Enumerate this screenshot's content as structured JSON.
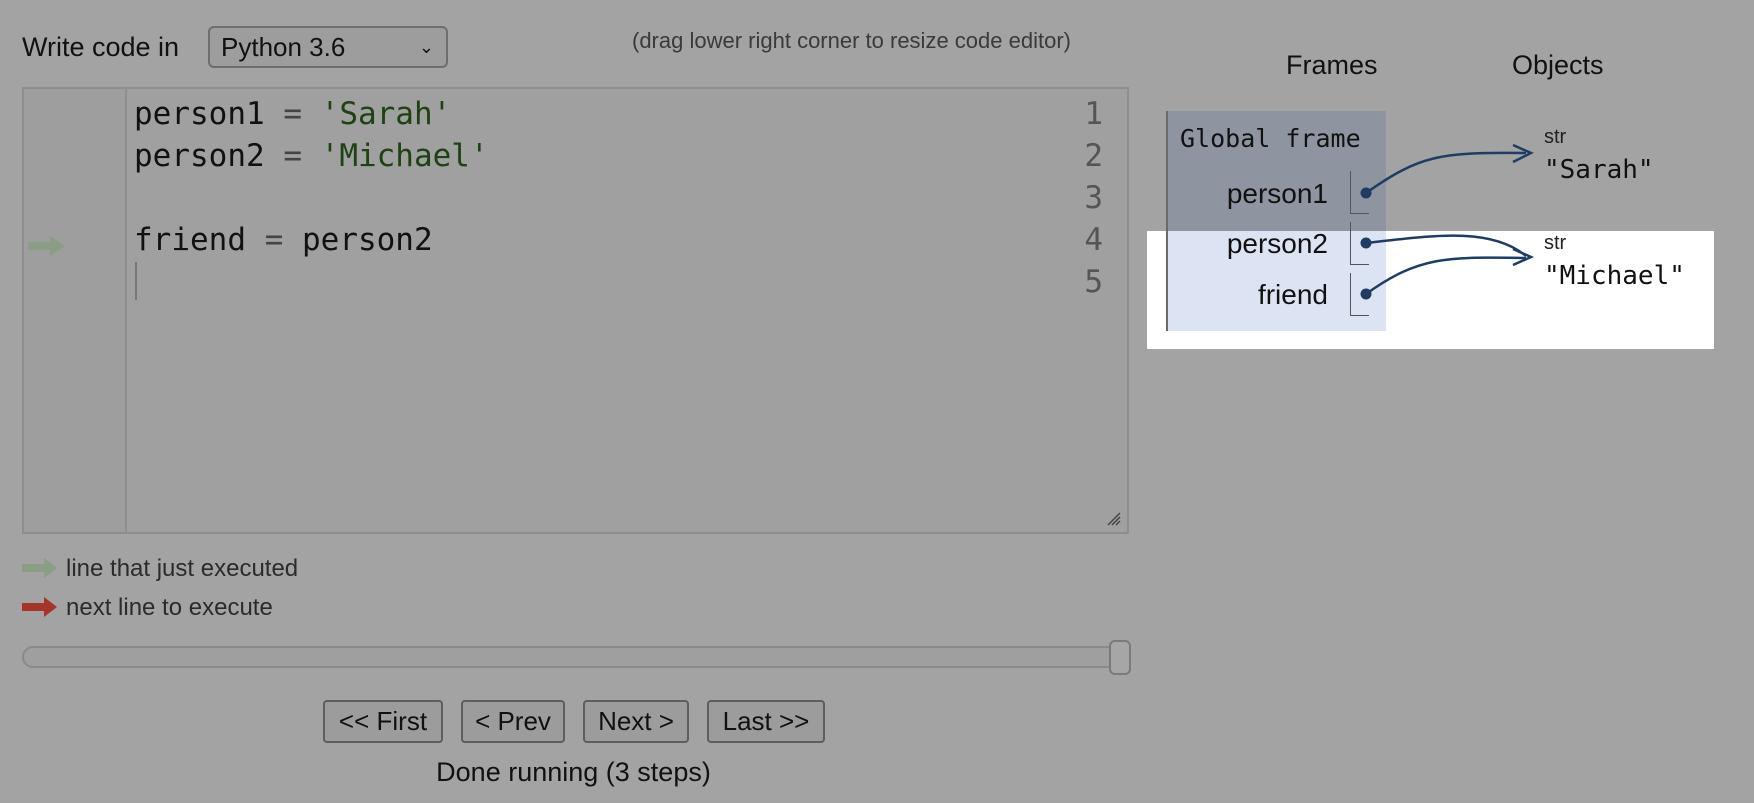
{
  "toolbar": {
    "lang_label": "Write code in",
    "lang_selected": "Python 3.6",
    "resize_hint": "(drag lower right corner to resize code editor)"
  },
  "editor": {
    "line_numbers": [
      "1",
      "2",
      "3",
      "4",
      "5"
    ],
    "current_line": 4
  },
  "legend": {
    "just_executed": "line that just executed",
    "next_to_execute": "next line to execute"
  },
  "slider": {
    "position": 1.0
  },
  "nav": {
    "first": "<< First",
    "prev": "< Prev",
    "next": "Next >",
    "last": "Last >>",
    "status": "Done running (3 steps)"
  },
  "viz": {
    "frames_header": "Frames",
    "objects_header": "Objects",
    "global_frame": "Global frame",
    "vars": [
      "person1",
      "person2",
      "friend"
    ],
    "objects": [
      {
        "type": "str",
        "value": "\"Sarah\""
      },
      {
        "type": "str",
        "value": "\"Michael\""
      }
    ]
  },
  "colors": {
    "arrow_green": "#8a9e86",
    "arrow_red": "#a3352a",
    "pointer": "#1f3d63"
  }
}
